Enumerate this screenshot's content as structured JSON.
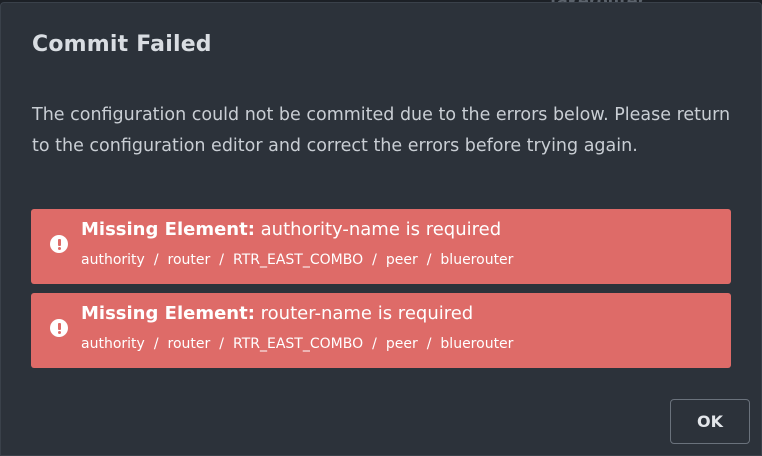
{
  "background": {
    "partial_text": "fakerouter"
  },
  "dialog": {
    "title": "Commit Failed",
    "message": "The configuration could not be commited due to the errors below. Please return to the configuration editor and correct the errors before trying again.",
    "errors": [
      {
        "icon": "exclamation-circle-icon",
        "label": "Missing Element:",
        "text": "authority-name is required",
        "path": [
          "authority",
          "router",
          "RTR_EAST_COMBO",
          "peer",
          "bluerouter"
        ]
      },
      {
        "icon": "exclamation-circle-icon",
        "label": "Missing Element:",
        "text": "router-name is required",
        "path": [
          "authority",
          "router",
          "RTR_EAST_COMBO",
          "peer",
          "bluerouter"
        ]
      }
    ],
    "path_separator": "/",
    "ok_label": "OK"
  },
  "colors": {
    "dialog_bg": "#2c323a",
    "error_bg": "#de6b68",
    "text": "#c9ced4"
  }
}
